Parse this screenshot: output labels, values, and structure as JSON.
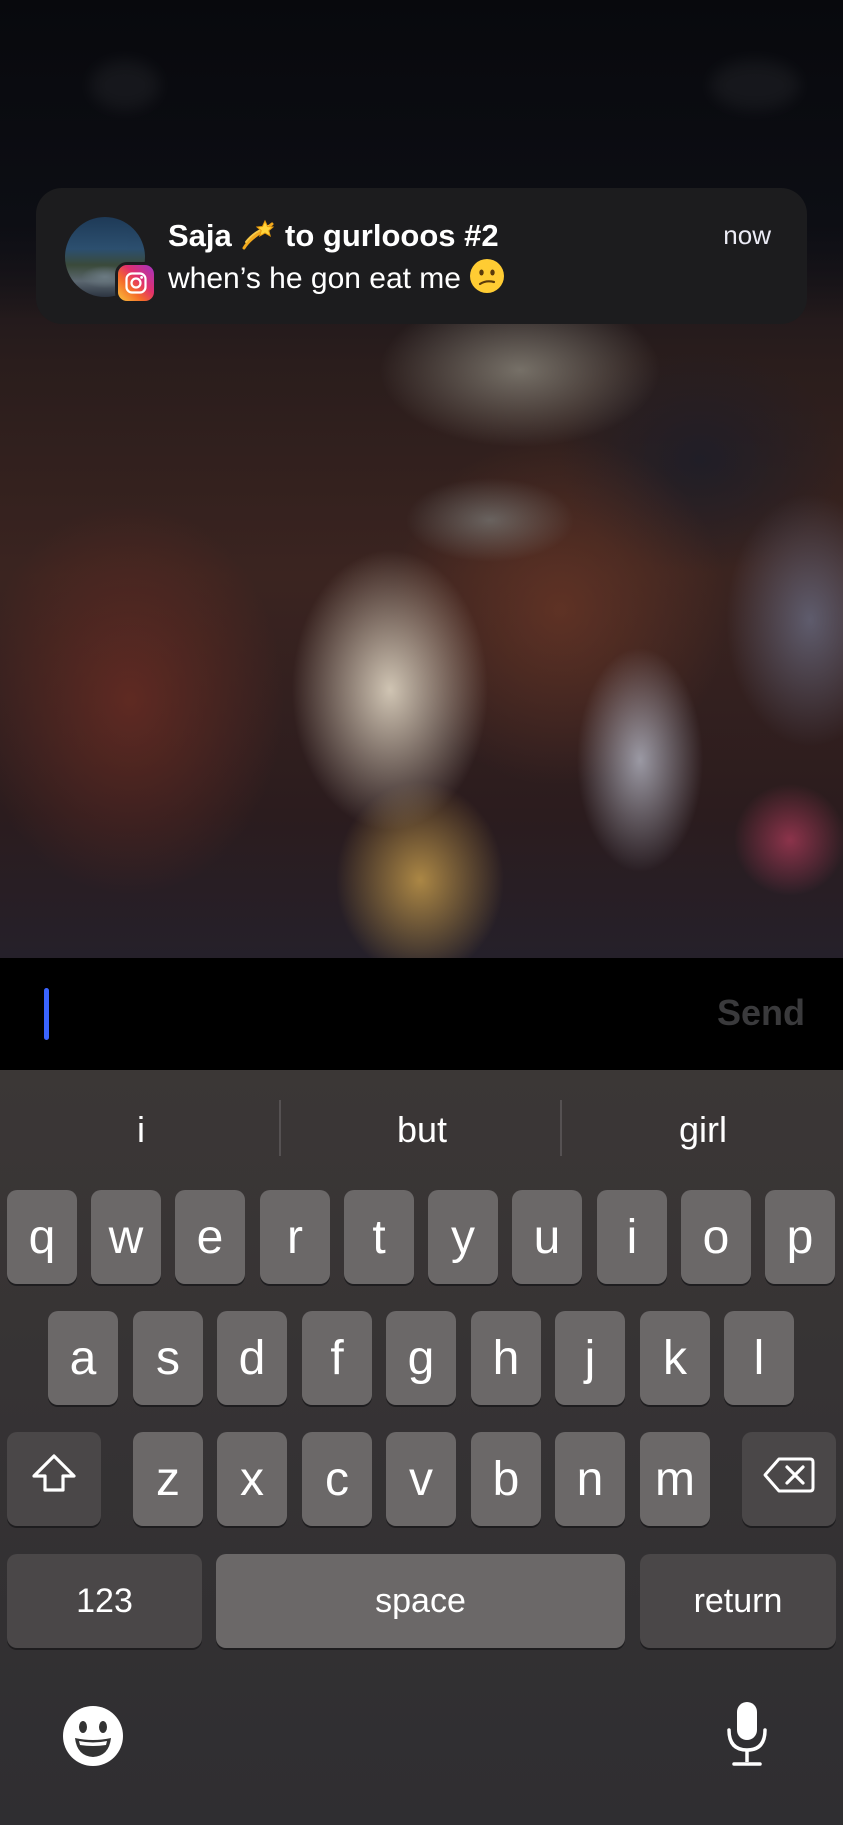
{
  "notification": {
    "title_name": "Saja",
    "title_emoji": "dizzy-emoji",
    "title_rest": "to gurlooos #2",
    "body": "when’s he gon eat me",
    "body_emoji": "confused-face-emoji",
    "time": "now",
    "app_badge": "instagram-icon"
  },
  "input": {
    "send_label": "Send"
  },
  "keyboard": {
    "suggestions": [
      "i",
      "but",
      "girl"
    ],
    "row1": [
      "q",
      "w",
      "e",
      "r",
      "t",
      "y",
      "u",
      "i",
      "o",
      "p"
    ],
    "row2": [
      "a",
      "s",
      "d",
      "f",
      "g",
      "h",
      "j",
      "k",
      "l"
    ],
    "row3": [
      "z",
      "x",
      "c",
      "v",
      "b",
      "n",
      "m"
    ],
    "numbers_label": "123",
    "space_label": "space",
    "return_label": "return",
    "shift_icon": "shift-icon",
    "delete_icon": "delete-icon",
    "emoji_icon": "emoji-icon",
    "mic_icon": "microphone-icon"
  }
}
